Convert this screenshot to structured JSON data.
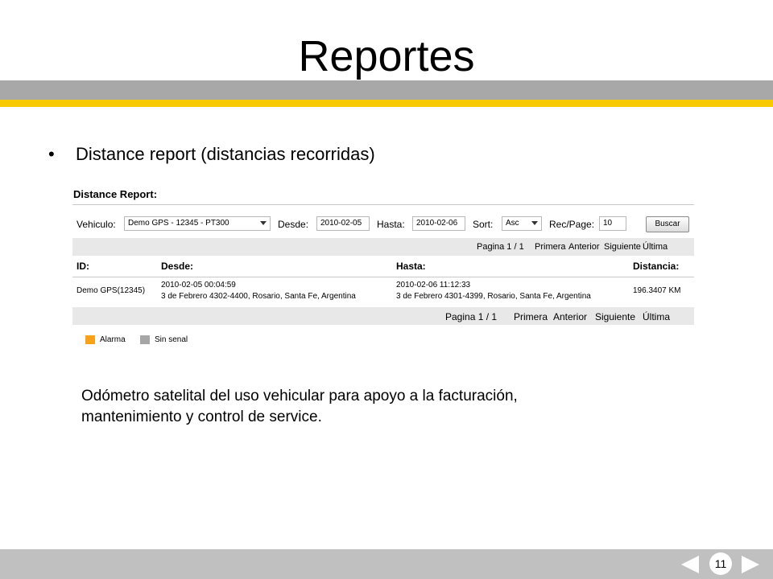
{
  "slide": {
    "title": "Reportes",
    "bullet_symbol": "•",
    "bullet": "Distance report (distancias recorridas)",
    "body_lines": [
      "Odómetro satelital del uso vehicular para apoyo a la facturación,",
      "mantenimiento y control de service."
    ],
    "page_number": "11"
  },
  "report": {
    "title": "Distance Report:",
    "filters": {
      "vehiculo_label": "Vehiculo:",
      "vehiculo_value": "Demo GPS - 12345 - PT300",
      "desde_label": "Desde:",
      "desde_value": "2010-02-05",
      "hasta_label": "Hasta:",
      "hasta_value": "2010-02-06",
      "sort_label": "Sort:",
      "sort_value": "Asc",
      "recpage_label": "Rec/Page:",
      "recpage_value": "10",
      "search_button": "Buscar"
    },
    "pager": {
      "info": "Pagina 1 / 1",
      "first": "Primera",
      "prev": "Anterior",
      "next": "Siguiente",
      "last": "Última"
    },
    "columns": [
      "ID:",
      "Desde:",
      "Hasta:",
      "Distancia:"
    ],
    "rows": [
      {
        "id": "Demo GPS(12345)",
        "desde_time": "2010-02-05 00:04:59",
        "desde_address": "3 de Febrero 4302-4400, Rosario, Santa Fe, Argentina",
        "hasta_time": "2010-02-06 11:12:33",
        "hasta_address": "3 de Febrero 4301-4399, Rosario, Santa Fe, Argentina",
        "distancia": "196.3407 KM"
      }
    ],
    "legend": [
      {
        "label": "Alarma",
        "color": "#f7a21b"
      },
      {
        "label": "Sin senal",
        "color": "#a6a6a6"
      }
    ]
  },
  "colors": {
    "header_band": "#a8a8a8",
    "accent_band": "#f7c900",
    "footer_band": "#c0c0c0"
  },
  "icons": {
    "prev": "triangle-left-icon",
    "next": "triangle-right-icon",
    "select": "chevron-down-icon"
  }
}
